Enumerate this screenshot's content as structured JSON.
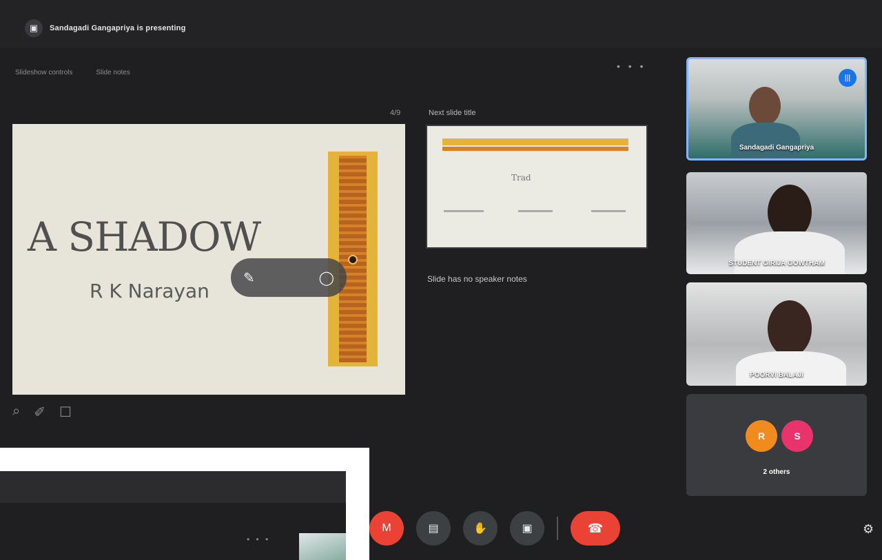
{
  "presenting": {
    "text": "Sandagadi Gangapriya is presenting",
    "icon": "presentation-icon"
  },
  "slide_toolbar": {
    "items": [
      "Slideshow controls",
      "Slide notes"
    ]
  },
  "more_dots": "• • •",
  "slide": {
    "title": "A SHADOW",
    "author": "R K Narayan",
    "controls": {
      "mic_icon": "✎",
      "pointer_icon": "◯"
    }
  },
  "next": {
    "count": "4/9",
    "label": "Next slide title",
    "thumb_title": "Trad"
  },
  "notes": {
    "text": "Slide has no speaker notes"
  },
  "slide_tools": [
    "⌕",
    "✐",
    "☐"
  ],
  "participants": [
    {
      "name": "Sandagadi Gangapriya",
      "speaking": true
    },
    {
      "name": "STUDENT GIRIJA GOWTHAM"
    },
    {
      "name": "POORVI BALAJI"
    }
  ],
  "others": {
    "avatars": [
      {
        "initial": "R",
        "color": "#f28b1e"
      },
      {
        "initial": "S",
        "color": "#e8336d"
      }
    ],
    "label": "2 others"
  },
  "controls": {
    "mic": "M",
    "captions": "▤",
    "raise_hand": "✋",
    "present": "▣",
    "end_call": "☎"
  },
  "edge_icon": "⚙"
}
